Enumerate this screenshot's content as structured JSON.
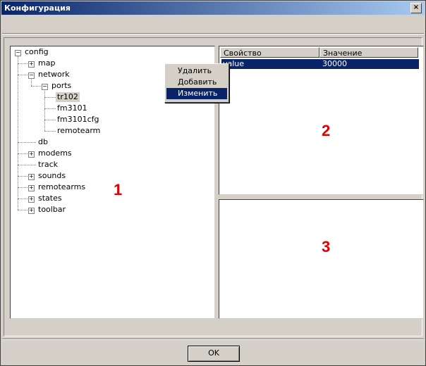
{
  "window": {
    "title": "Конфигурация",
    "close_label": "×"
  },
  "tree": {
    "nodes": [
      {
        "label": "config"
      },
      {
        "label": "map"
      },
      {
        "label": "network"
      },
      {
        "label": "ports"
      },
      {
        "label": "tr102"
      },
      {
        "label": "fm3101"
      },
      {
        "label": "fm3101cfg"
      },
      {
        "label": "remotearm"
      },
      {
        "label": "db"
      },
      {
        "label": "modems"
      },
      {
        "label": "track"
      },
      {
        "label": "sounds"
      },
      {
        "label": "remotearms"
      },
      {
        "label": "states"
      },
      {
        "label": "toolbar"
      }
    ]
  },
  "context_menu": {
    "items": [
      "Удалить",
      "Добавить",
      "Изменить"
    ]
  },
  "properties": {
    "columns": [
      "Свойство",
      "Значение"
    ],
    "rows": [
      {
        "name": "value",
        "value": "30000"
      }
    ]
  },
  "annotations": {
    "n1": "1",
    "n2": "2",
    "n3": "3"
  },
  "footer": {
    "ok_label": "OK"
  }
}
